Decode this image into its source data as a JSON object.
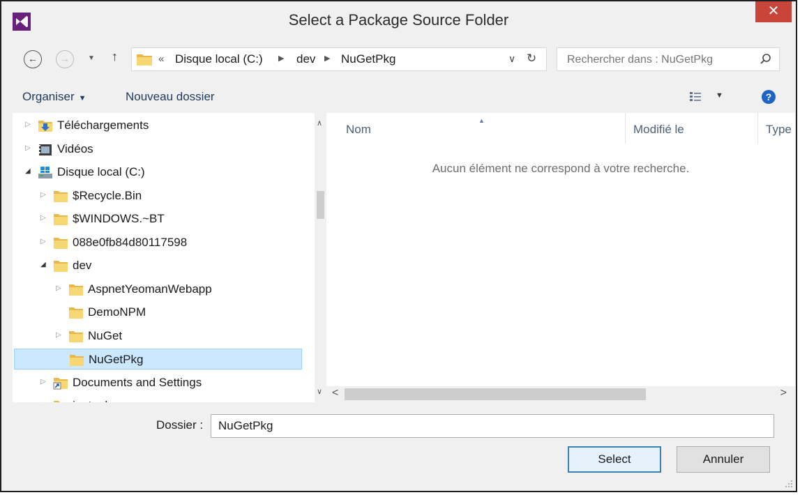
{
  "window": {
    "title": "Select a Package Source Folder",
    "close": "✕"
  },
  "address": {
    "overflow": "«",
    "crumbs": [
      "Disque local (C:)",
      "dev",
      "NuGetPkg"
    ],
    "search_placeholder": "Rechercher dans : NuGetPkg"
  },
  "toolbar": {
    "organize": "Organiser",
    "new_folder": "Nouveau dossier",
    "help": "?"
  },
  "tree": {
    "items": [
      {
        "label": "Téléchargements",
        "icon": "downloads-icon",
        "expander": "▷"
      },
      {
        "label": "Vidéos",
        "icon": "videos-icon",
        "expander": "▷"
      },
      {
        "label": "Disque local (C:)",
        "icon": "drive-icon",
        "expander": "◢"
      },
      {
        "label": "$Recycle.Bin",
        "icon": "folder-icon",
        "expander": "▷"
      },
      {
        "label": "$WINDOWS.~BT",
        "icon": "folder-icon",
        "expander": "▷"
      },
      {
        "label": "088e0fb84d80117598",
        "icon": "folder-icon",
        "expander": "▷"
      },
      {
        "label": "dev",
        "icon": "folder-icon",
        "expander": "◢"
      },
      {
        "label": "AspnetYeomanWebapp",
        "icon": "folder-icon",
        "expander": "▷"
      },
      {
        "label": "DemoNPM",
        "icon": "folder-icon",
        "expander": ""
      },
      {
        "label": "NuGet",
        "icon": "folder-icon",
        "expander": "▷"
      },
      {
        "label": "NuGetPkg",
        "icon": "folder-icon",
        "expander": ""
      },
      {
        "label": "Documents and Settings",
        "icon": "shortcut-folder-icon",
        "expander": "▷"
      },
      {
        "label": "inetpub",
        "icon": "folder-icon",
        "expander": "▷"
      }
    ]
  },
  "list": {
    "columns": [
      "Nom",
      "Modifié le",
      "Type"
    ],
    "empty_message": "Aucun élément ne correspond à votre recherche."
  },
  "footer": {
    "folder_label": "Dossier :",
    "folder_value": "NuGetPkg",
    "select_button": "Select",
    "cancel_button": "Annuler"
  }
}
